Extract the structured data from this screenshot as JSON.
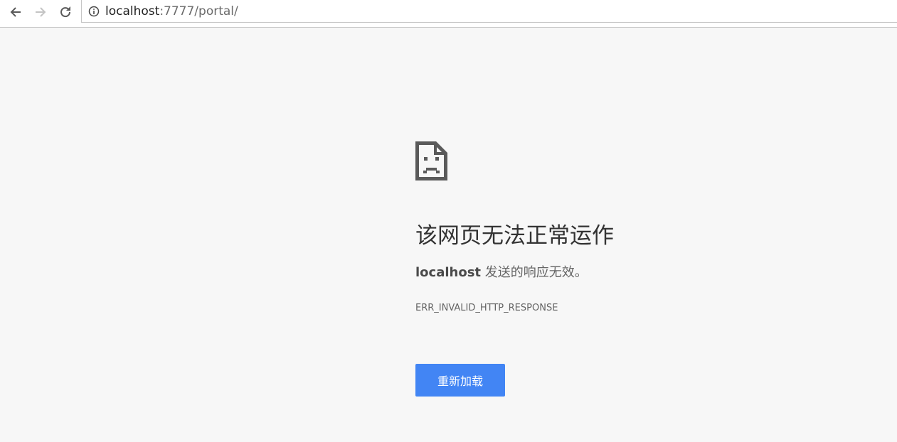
{
  "browser": {
    "back_icon": "back-arrow-icon",
    "forward_icon": "forward-arrow-icon",
    "reload_icon": "reload-icon",
    "info_icon": "info-icon",
    "url_host": "localhost",
    "url_rest": ":7777/portal/"
  },
  "error": {
    "icon": "sad-page-icon",
    "title": "该网页无法正常运作",
    "host": "localhost",
    "message": " 发送的响应无效。",
    "code": "ERR_INVALID_HTTP_RESPONSE",
    "reload_label": "重新加载"
  },
  "colors": {
    "page_background": "#f7f7f7",
    "button_blue": "#4285f4",
    "icon_gray": "#5a5a5a"
  }
}
